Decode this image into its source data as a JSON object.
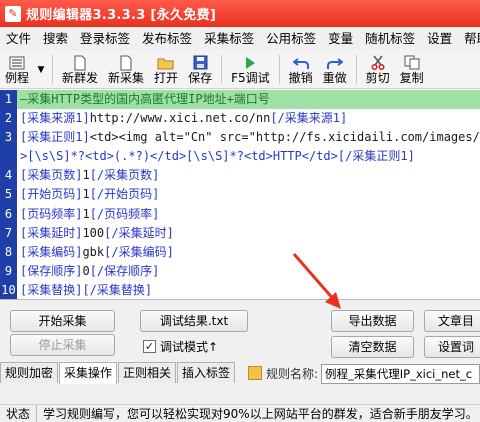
{
  "window": {
    "title": "规则编辑器3.3.3.3 [永久免费]"
  },
  "menu": [
    "文件",
    "搜索",
    "登录标签",
    "发布标签",
    "采集标签",
    "公用标签",
    "变量",
    "随机标签",
    "设置",
    "帮助"
  ],
  "toolbar": {
    "example": "例程",
    "new_post": "新群发",
    "new_collect": "新采集",
    "open": "打开",
    "save": "保存",
    "f5_debug": "F5调试",
    "undo": "撤销",
    "redo": "重做",
    "cut": "剪切",
    "copy": "复制"
  },
  "editor": {
    "line_numbers": [
      "1",
      "2",
      "3",
      "4",
      "5",
      "6",
      "7",
      "8",
      "9",
      "10"
    ],
    "lines": [
      {
        "text": "—采集HTTP类型的国内高匿代理IP地址+端口号"
      },
      {
        "open": "[采集来源1]",
        "value": "http://www.xici.net.co/nn",
        "close": "[/采集来源1]"
      },
      {
        "open": "[采集正则1]",
        "value": "<td><img alt=\"Cn\" src=\"http://fs.xicidaili.com/images/fl",
        "close": ""
      },
      {
        "open": ">[\\s\\S]*?<td>(.*?)</td>[\\s\\S]*?<td>HTTP</td>",
        "value": "",
        "close": "[/采集正则1]"
      },
      {
        "open": "[采集页数]",
        "value": "1",
        "close": "[/采集页数]"
      },
      {
        "open": "[开始页码]",
        "value": "1",
        "close": "[/开始页码]"
      },
      {
        "open": "[页码频率]",
        "value": "1",
        "close": "[/页码频率]"
      },
      {
        "open": "[采集延时]",
        "value": "100",
        "close": "[/采集延时]"
      },
      {
        "open": "[采集编码]",
        "value": "gbk",
        "close": "[/采集编码]"
      },
      {
        "open": "[保存顺序]",
        "value": "0",
        "close": "[/保存顺序]"
      },
      {
        "open": "[采集替换]",
        "value": "",
        "close": "[/采集替换]"
      }
    ]
  },
  "actions": {
    "start_collect": "开始采集",
    "stop_collect": "停止采集",
    "debug_result": "调试结果.txt",
    "debug_mode": "调试模式↑",
    "export_data": "导出数据",
    "clear_data": "清空数据",
    "article": "文章目",
    "settings_word": "设置词"
  },
  "tabs": [
    "规则加密",
    "采集操作",
    "正则相关",
    "插入标签"
  ],
  "rule_name": {
    "label": "规则名称:",
    "value": "例程_采集代理IP_xici_net_c"
  },
  "status": {
    "label": "状态",
    "text": "学习规则编写，您可以轻松实现对90%以上网站平台的群发，适合新手朋友学习。"
  },
  "colors": {
    "title_bar": "#e8321f",
    "gutter": "#1e3fa8",
    "active_line": "#9fe0a7",
    "tag_color": "#2a35c8",
    "annotation_arrow": "#e8321f"
  }
}
